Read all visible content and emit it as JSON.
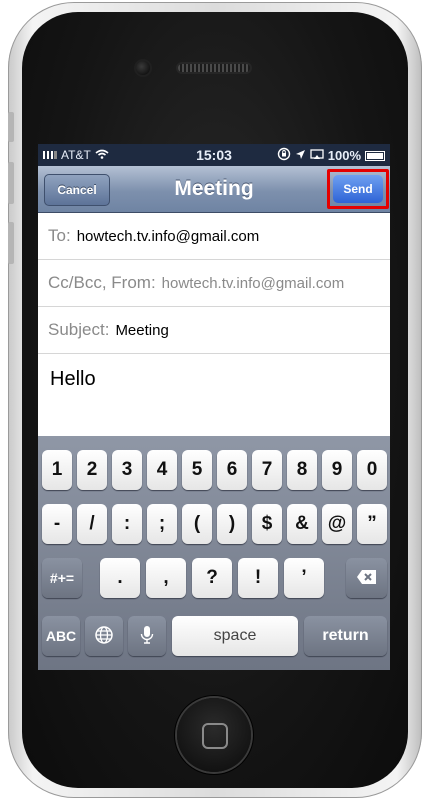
{
  "status_bar": {
    "carrier": "AT&T",
    "time": "15:03",
    "battery": "100%"
  },
  "nav": {
    "title": "Meeting",
    "cancel_label": "Cancel",
    "send_label": "Send"
  },
  "fields": {
    "to_label": "To:",
    "to_value": "howtech.tv.info@gmail.com",
    "cc_label": "Cc/Bcc, From:",
    "from_value": "howtech.tv.info@gmail.com",
    "subject_label": "Subject:",
    "subject_value": "Meeting"
  },
  "body": {
    "text": "Hello"
  },
  "keyboard": {
    "row1": [
      "1",
      "2",
      "3",
      "4",
      "5",
      "6",
      "7",
      "8",
      "9",
      "0"
    ],
    "row2": [
      "-",
      "/",
      ":",
      ";",
      "(",
      ")",
      "$",
      "&",
      "@",
      "”"
    ],
    "row3_symbols": "#+=",
    "row3": [
      ".",
      ",",
      "?",
      "!",
      "’"
    ],
    "abc": "ABC",
    "space": "space",
    "return": "return"
  },
  "icons": [
    "wifi-icon",
    "lock-rotation-icon",
    "location-icon",
    "battery-icon",
    "backspace-icon",
    "globe-icon",
    "microphone-icon"
  ],
  "colors": {
    "highlight": "#e50000",
    "send_blue": "#2e63d6",
    "nav_bar": "#7d90ad"
  }
}
